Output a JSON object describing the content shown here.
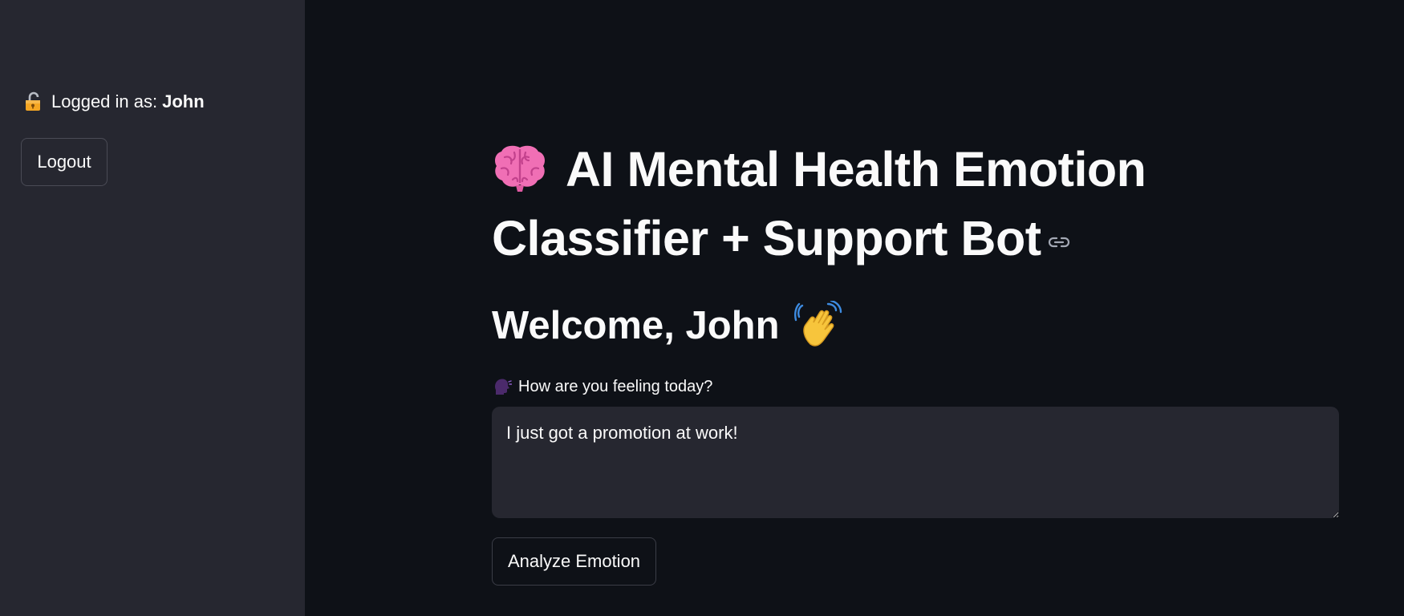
{
  "sidebar": {
    "login_prefix": "Logged in as:",
    "user_name": "John",
    "logout_label": "Logout",
    "lock_icon": "unlocked-lock-icon"
  },
  "main": {
    "title": "AI Mental Health Emotion Classifier + Support Bot",
    "title_icon": "brain-icon",
    "anchor_icon": "link-icon",
    "welcome": "Welcome, John",
    "welcome_icon": "waving-hand-icon",
    "feeling_label": "How are you feeling today?",
    "feeling_icon": "speaking-head-icon",
    "feeling_value": "I just got a promotion at work!",
    "analyze_label": "Analyze Emotion"
  },
  "colors": {
    "background": "#0e1117",
    "sidebar": "#262730",
    "input_bg": "#262730",
    "text": "#fafafa"
  }
}
